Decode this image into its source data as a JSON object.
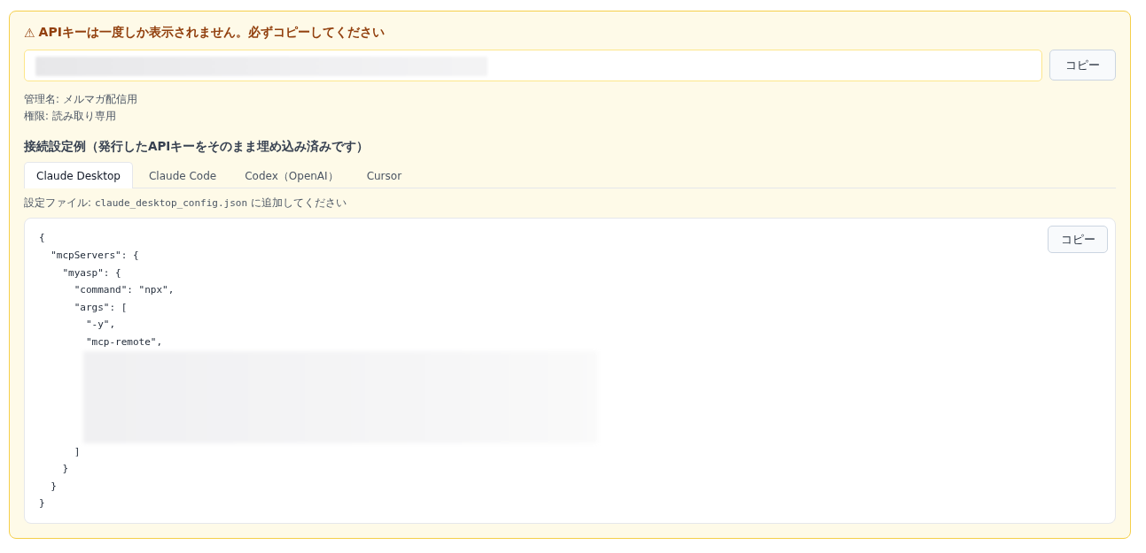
{
  "warning": {
    "icon": "⚠",
    "text": "APIキーは一度しか表示されません。必ずコピーしてください"
  },
  "api_key_field": {
    "redacted": true
  },
  "copy_key_button": "コピー",
  "meta": [
    "管理名: メルマガ配信用",
    "権限: 読み取り専用"
  ],
  "section_title": "接続設定例（発行したAPIキーをそのまま埋め込み済みです）",
  "tabs": [
    {
      "label": "Claude Desktop",
      "selected": true
    },
    {
      "label": "Claude Code",
      "selected": false
    },
    {
      "label": "Codex（OpenAI）",
      "selected": false
    },
    {
      "label": "Cursor",
      "selected": false
    }
  ],
  "config_hint": {
    "before": "設定ファイル:",
    "file": "claude_desktop_config.json",
    "after": "に追加してください"
  },
  "code_block": {
    "copy_button": "コピー",
    "lines": [
      {
        "kind": "code",
        "text": "{"
      },
      {
        "kind": "code",
        "text": "  \"mcpServers\": {"
      },
      {
        "kind": "code",
        "text": "    \"myasp\": {"
      },
      {
        "kind": "code",
        "text": "      \"command\": \"npx\","
      },
      {
        "kind": "code",
        "text": "      \"args\": ["
      },
      {
        "kind": "code",
        "text": "        \"-y\","
      },
      {
        "kind": "code",
        "text": "        \"mcp-remote\","
      },
      {
        "kind": "redacted"
      },
      {
        "kind": "code",
        "text": "      ]"
      },
      {
        "kind": "code",
        "text": "    }"
      },
      {
        "kind": "code",
        "text": "  }"
      },
      {
        "kind": "code",
        "text": "}"
      }
    ]
  }
}
